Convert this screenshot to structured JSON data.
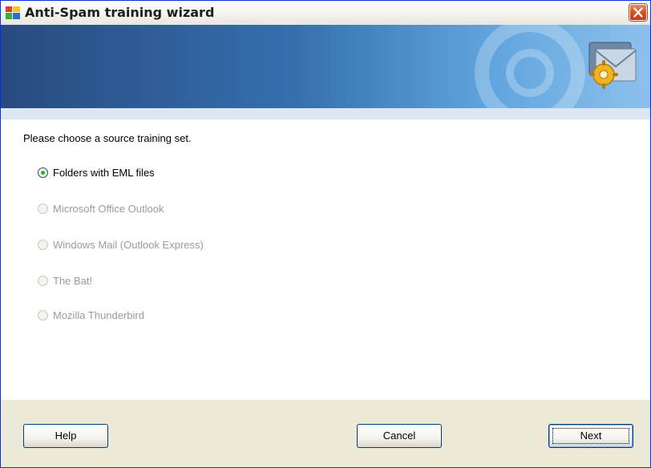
{
  "window": {
    "title": "Anti-Spam training wizard"
  },
  "prompt": "Please choose a source training set.",
  "options": [
    {
      "label": "Folders with EML files",
      "selected": true,
      "enabled": true
    },
    {
      "label": "Microsoft Office Outlook",
      "selected": false,
      "enabled": false
    },
    {
      "label": "Windows Mail (Outlook Express)",
      "selected": false,
      "enabled": false
    },
    {
      "label": "The Bat!",
      "selected": false,
      "enabled": false
    },
    {
      "label": "Mozilla Thunderbird",
      "selected": false,
      "enabled": false
    }
  ],
  "buttons": {
    "help": "Help",
    "cancel": "Cancel",
    "next": "Next"
  },
  "colors": {
    "banner_dark": "#284a80",
    "banner_light": "#8dc1ec",
    "radio_dot": "#21a121",
    "disabled_text": "#9b9b96"
  },
  "icons": {
    "app": "avg-logo-icon",
    "close": "close-icon",
    "banner": "wizard-envelope-gear-icon"
  }
}
